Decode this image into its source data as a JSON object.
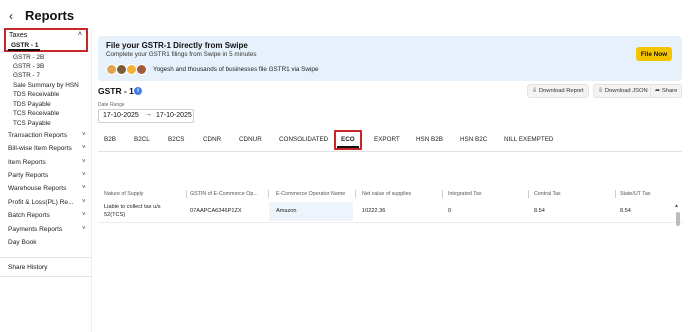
{
  "header": {
    "title": "Reports"
  },
  "sidebar": {
    "taxes": {
      "label": "Taxes",
      "selected": "GSTR - 1",
      "items": [
        "GSTR - 2B",
        "GSTR - 3B",
        "GSTR - 7",
        "Sale Summary by HSN",
        "TDS Receivable",
        "TDS Payable",
        "TCS Receivable",
        "TCS Payable"
      ]
    },
    "categories": [
      "Transaction Reports",
      "Bill-wise Item Reports",
      "Item Reports",
      "Party Reports",
      "Warehouse Reports",
      "Profit & Loss(PL) Re...",
      "Batch Reports",
      "Payments Reports"
    ],
    "day_book": "Day Book",
    "share_history": "Share History"
  },
  "banner": {
    "title": "File your GSTR-1 Directly from Swipe",
    "subtitle": "Complete your GSTR1 filings from Swipe in 5 minutes",
    "note": "Yogesh and thousands of businesses file GSTR1 via Swipe",
    "button": "File Now",
    "avatar_colors": [
      "#e0a44f",
      "#7b5b3a",
      "#f2b134",
      "#a55a3c"
    ]
  },
  "report": {
    "title": "GSTR - 1",
    "date_label": "Date Range",
    "date_from": "17-10-2025",
    "date_to": "17-10-2025",
    "download_report": "Download Report",
    "download_json": "Download JSON",
    "share": "Share"
  },
  "tabs": [
    "B2B",
    "B2CL",
    "B2CS",
    "CDNR",
    "CDNUR",
    "CONSOLIDATED",
    "ECO",
    "EXPORT",
    "HSN B2B",
    "HSN B2C",
    "NILL EXEMPTED"
  ],
  "active_tab": "ECO",
  "table": {
    "columns": [
      "Nature of Supply",
      "GSTIN of E-Commerce Op...",
      "E-Commerce Operator Name",
      "Net value of supplies",
      "Integrated Tax",
      "Central Tax",
      "State/UT Tax"
    ],
    "rows": [
      {
        "nature_line1": "Liable to collect tax u/s",
        "nature_line2": "52(TCS)",
        "gstin": "07AAPCA6346P1ZX",
        "operator": "Amazon",
        "net_value": "10222.36",
        "igst": "0",
        "cgst": "8.54",
        "sgst": "8.54"
      }
    ]
  },
  "colors": {
    "accent_red": "#c62828",
    "banner_bg": "#e7f1fb",
    "file_button": "#f5c400",
    "info_blue": "#3f7ee8"
  }
}
